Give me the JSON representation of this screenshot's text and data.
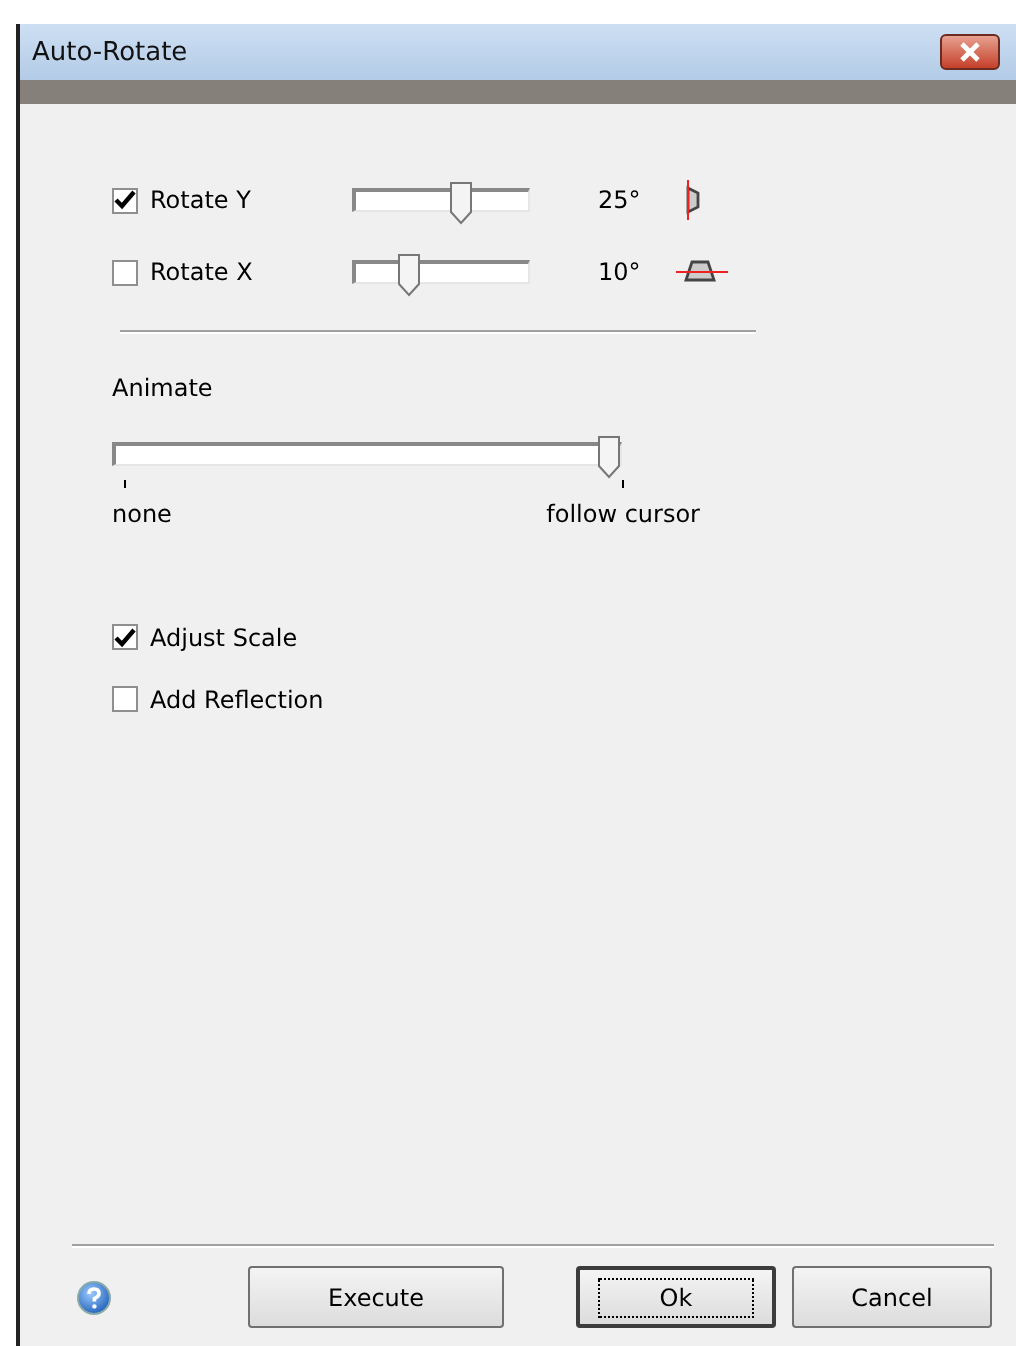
{
  "window": {
    "title": "Auto-Rotate"
  },
  "rotations": [
    {
      "label": "Rotate Y",
      "checked": true,
      "level": 0.62,
      "reading": "25°",
      "kind": "vertical"
    },
    {
      "label": "Rotate X",
      "checked": false,
      "level": 0.28,
      "reading": "10°",
      "kind": "horizontal"
    }
  ],
  "animate": {
    "label": "Animate",
    "level": 1,
    "min_label": "none",
    "max_label": "follow cursor"
  },
  "options": [
    {
      "label": "Adjust Scale",
      "checked": true
    },
    {
      "label": "Add Reflection",
      "checked": false
    }
  ],
  "buttons": [
    {
      "label": "Execute",
      "focused": false
    },
    {
      "label": "Ok",
      "focused": true
    },
    {
      "label": "Cancel",
      "focused": false
    }
  ]
}
